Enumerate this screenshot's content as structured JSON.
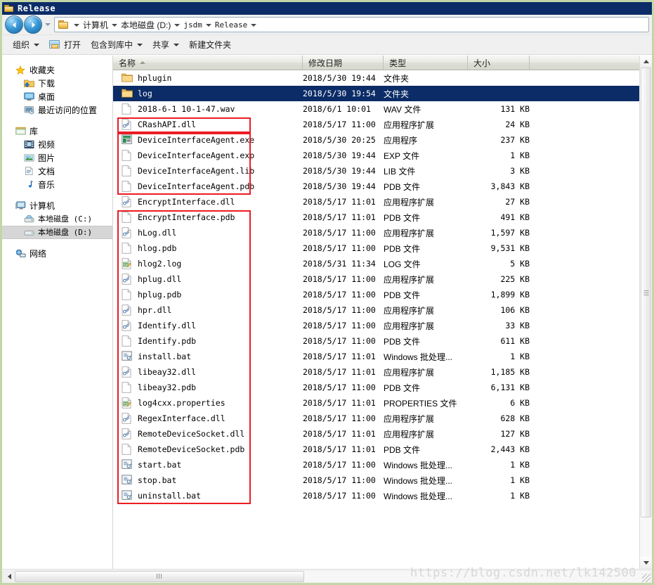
{
  "window": {
    "title": "Release",
    "title_icon": "folder-icon"
  },
  "address_bar": {
    "back_label": "←",
    "forward_label": "→",
    "recent_dropdown": "chevron-down-icon",
    "folder_icon": "folder-icon",
    "crumbs": [
      "计算机",
      "本地磁盘 (D:)",
      "jsdm",
      "Release"
    ]
  },
  "toolbar": {
    "items": [
      {
        "label": "组织",
        "has_caret": true,
        "icon": null
      },
      {
        "label": "打开",
        "has_caret": false,
        "icon": "open-folder-icon"
      },
      {
        "label": "包含到库中",
        "has_caret": true,
        "icon": null
      },
      {
        "label": "共享",
        "has_caret": true,
        "icon": null
      },
      {
        "label": "新建文件夹",
        "has_caret": false,
        "icon": null
      }
    ]
  },
  "sidebar": {
    "groups": [
      {
        "header": {
          "label": "收藏夹",
          "icon": "star-icon"
        },
        "items": [
          {
            "label": "下载",
            "icon": "download-folder-icon"
          },
          {
            "label": "桌面",
            "icon": "desktop-icon"
          },
          {
            "label": "最近访问的位置",
            "icon": "recent-places-icon"
          }
        ]
      },
      {
        "header": {
          "label": "库",
          "icon": "library-icon"
        },
        "items": [
          {
            "label": "视频",
            "icon": "video-icon"
          },
          {
            "label": "图片",
            "icon": "pictures-icon"
          },
          {
            "label": "文档",
            "icon": "documents-icon"
          },
          {
            "label": "音乐",
            "icon": "music-icon"
          }
        ]
      },
      {
        "header": {
          "label": "计算机",
          "icon": "computer-icon"
        },
        "items": [
          {
            "label": "本地磁盘 (C:)",
            "icon": "system-drive-icon",
            "selected": false
          },
          {
            "label": "本地磁盘 (D:)",
            "icon": "drive-icon",
            "selected": true
          }
        ]
      },
      {
        "header": {
          "label": "网络",
          "icon": "network-icon"
        },
        "items": []
      }
    ]
  },
  "file_list": {
    "columns": [
      {
        "label": "名称",
        "sorted": "asc"
      },
      {
        "label": "修改日期",
        "sorted": null
      },
      {
        "label": "类型",
        "sorted": null
      },
      {
        "label": "大小",
        "sorted": null
      }
    ],
    "rows": [
      {
        "name": "hplugin",
        "date": "2018/5/30 19:44",
        "type": "文件夹",
        "size": "",
        "icon": "folder-icon",
        "selected": false
      },
      {
        "name": "log",
        "date": "2018/5/30 19:54",
        "type": "文件夹",
        "size": "",
        "icon": "folder-icon",
        "selected": true
      },
      {
        "name": "2018-6-1 10-1-47.wav",
        "date": "2018/6/1 10:01",
        "type": "WAV 文件",
        "size": "131 KB",
        "icon": "file-icon",
        "selected": false
      },
      {
        "name": "CRashAPI.dll",
        "date": "2018/5/17 11:00",
        "type": "应用程序扩展",
        "size": "24 KB",
        "icon": "dll-icon",
        "selected": false
      },
      {
        "name": "DeviceInterfaceAgent.exe",
        "date": "2018/5/30 20:25",
        "type": "应用程序",
        "size": "237 KB",
        "icon": "exe-icon",
        "selected": false
      },
      {
        "name": "DeviceInterfaceAgent.exp",
        "date": "2018/5/30 19:44",
        "type": "EXP 文件",
        "size": "1 KB",
        "icon": "file-icon",
        "selected": false
      },
      {
        "name": "DeviceInterfaceAgent.lib",
        "date": "2018/5/30 19:44",
        "type": "LIB 文件",
        "size": "3 KB",
        "icon": "file-icon",
        "selected": false
      },
      {
        "name": "DeviceInterfaceAgent.pdb",
        "date": "2018/5/30 19:44",
        "type": "PDB 文件",
        "size": "3,843 KB",
        "icon": "file-icon",
        "selected": false
      },
      {
        "name": "EncryptInterface.dll",
        "date": "2018/5/17 11:01",
        "type": "应用程序扩展",
        "size": "27 KB",
        "icon": "dll-icon",
        "selected": false
      },
      {
        "name": "EncryptInterface.pdb",
        "date": "2018/5/17 11:01",
        "type": "PDB 文件",
        "size": "491 KB",
        "icon": "file-icon",
        "selected": false
      },
      {
        "name": "hLog.dll",
        "date": "2018/5/17 11:00",
        "type": "应用程序扩展",
        "size": "1,597 KB",
        "icon": "dll-icon",
        "selected": false
      },
      {
        "name": "hlog.pdb",
        "date": "2018/5/17 11:00",
        "type": "PDB 文件",
        "size": "9,531 KB",
        "icon": "file-icon",
        "selected": false
      },
      {
        "name": "hlog2.log",
        "date": "2018/5/31 11:34",
        "type": "LOG 文件",
        "size": "5 KB",
        "icon": "log-icon",
        "selected": false
      },
      {
        "name": "hplug.dll",
        "date": "2018/5/17 11:00",
        "type": "应用程序扩展",
        "size": "225 KB",
        "icon": "dll-icon",
        "selected": false
      },
      {
        "name": "hplug.pdb",
        "date": "2018/5/17 11:00",
        "type": "PDB 文件",
        "size": "1,899 KB",
        "icon": "file-icon",
        "selected": false
      },
      {
        "name": "hpr.dll",
        "date": "2018/5/17 11:00",
        "type": "应用程序扩展",
        "size": "106 KB",
        "icon": "dll-icon",
        "selected": false
      },
      {
        "name": "Identify.dll",
        "date": "2018/5/17 11:00",
        "type": "应用程序扩展",
        "size": "33 KB",
        "icon": "dll-icon",
        "selected": false
      },
      {
        "name": "Identify.pdb",
        "date": "2018/5/17 11:00",
        "type": "PDB 文件",
        "size": "611 KB",
        "icon": "file-icon",
        "selected": false
      },
      {
        "name": "install.bat",
        "date": "2018/5/17 11:01",
        "type": "Windows 批处理...",
        "size": "1 KB",
        "icon": "bat-icon",
        "selected": false
      },
      {
        "name": "libeay32.dll",
        "date": "2018/5/17 11:01",
        "type": "应用程序扩展",
        "size": "1,185 KB",
        "icon": "dll-icon",
        "selected": false
      },
      {
        "name": "libeay32.pdb",
        "date": "2018/5/17 11:00",
        "type": "PDB 文件",
        "size": "6,131 KB",
        "icon": "file-icon",
        "selected": false
      },
      {
        "name": "log4cxx.properties",
        "date": "2018/5/17 11:01",
        "type": "PROPERTIES 文件",
        "size": "6 KB",
        "icon": "log-icon",
        "selected": false
      },
      {
        "name": "RegexInterface.dll",
        "date": "2018/5/17 11:00",
        "type": "应用程序扩展",
        "size": "628 KB",
        "icon": "dll-icon",
        "selected": false
      },
      {
        "name": "RemoteDeviceSocket.dll",
        "date": "2018/5/17 11:01",
        "type": "应用程序扩展",
        "size": "127 KB",
        "icon": "dll-icon",
        "selected": false
      },
      {
        "name": "RemoteDeviceSocket.pdb",
        "date": "2018/5/17 11:01",
        "type": "PDB 文件",
        "size": "2,443 KB",
        "icon": "file-icon",
        "selected": false
      },
      {
        "name": "start.bat",
        "date": "2018/5/17 11:00",
        "type": "Windows 批处理...",
        "size": "1 KB",
        "icon": "bat-icon",
        "selected": false
      },
      {
        "name": "stop.bat",
        "date": "2018/5/17 11:00",
        "type": "Windows 批处理...",
        "size": "1 KB",
        "icon": "bat-icon",
        "selected": false
      },
      {
        "name": "uninstall.bat",
        "date": "2018/5/17 11:00",
        "type": "Windows 批处理...",
        "size": "1 KB",
        "icon": "bat-icon",
        "selected": false
      }
    ],
    "annotations": [
      {
        "label": "highlight-crashapi",
        "color": "#ec1c24",
        "first_row": 3,
        "last_row": 3
      },
      {
        "label": "highlight-deviceagent",
        "color": "#ec1c24",
        "first_row": 4,
        "last_row": 7
      },
      {
        "label": "highlight-remaining",
        "color": "#ec1c24",
        "first_row": 9,
        "last_row": 27
      }
    ]
  },
  "scrollbars": {
    "vertical": {
      "up_label": "▲",
      "down_label": "▼"
    },
    "horizontal": {
      "left_label": "◀"
    }
  },
  "watermark": {
    "text": "https://blog.csdn.net/lk142500"
  }
}
